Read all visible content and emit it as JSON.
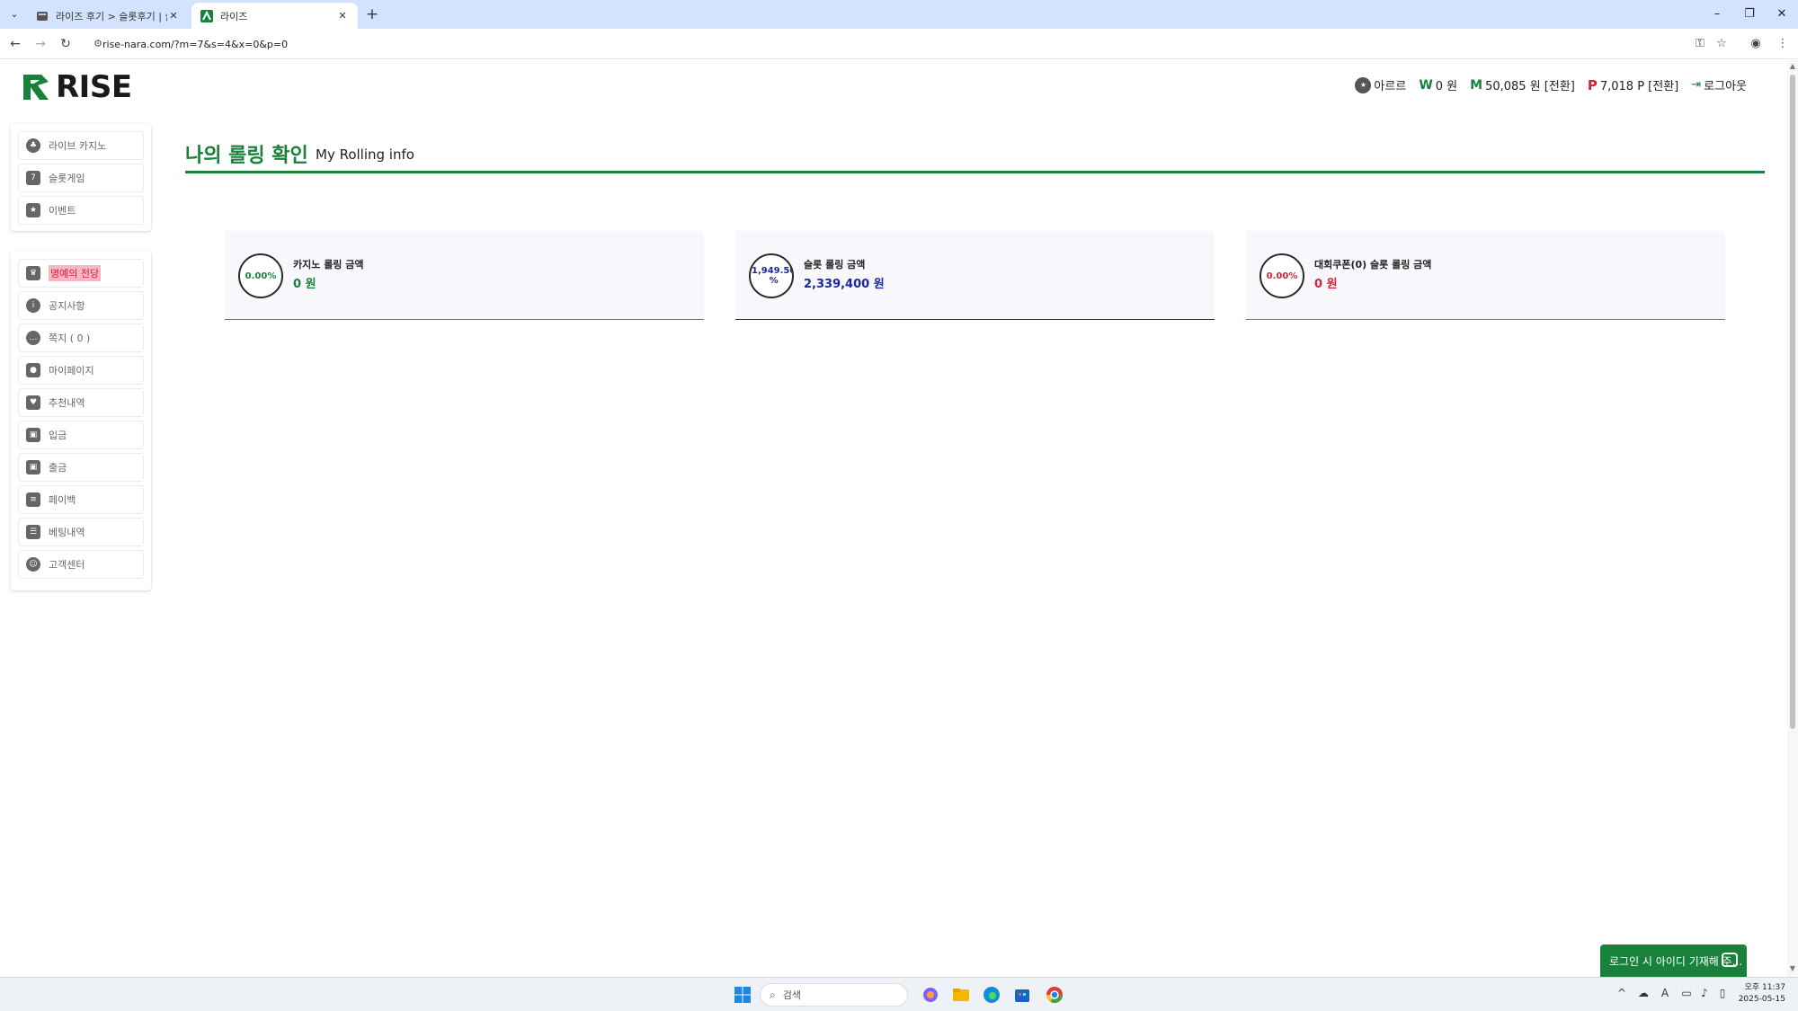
{
  "browser": {
    "tabs": [
      {
        "title": "라이즈 후기 > 슬롯후기 | 슬롯"
      },
      {
        "title": "라이즈"
      }
    ],
    "url": "rise-nara.com/?m=7&s=4&x=0&p=0",
    "window_controls": {
      "minimize": "–",
      "restore": "❐",
      "close": "✕"
    }
  },
  "site": {
    "logo_text": "RISE",
    "brand_color": "#19813b"
  },
  "userbar": {
    "username": "아르르",
    "won_symbol": "W",
    "won_value": "0 원",
    "mileage_symbol": "M",
    "mileage_value": "50,085 원 [전환]",
    "point_symbol": "P",
    "point_value": "7,018 P [전환]",
    "logout_label": "로그아웃"
  },
  "sidebar": {
    "top_items": [
      {
        "label": "라이브 카지노",
        "icon": "casino-icon"
      },
      {
        "label": "슬롯게임",
        "icon": "slot-icon"
      },
      {
        "label": "이벤트",
        "icon": "star-icon"
      }
    ],
    "bottom_items": [
      {
        "label": "명예의 전당",
        "icon": "trophy-icon",
        "highlight": true
      },
      {
        "label": "공지사항",
        "icon": "info-icon"
      },
      {
        "label": "쪽지 ( 0 )",
        "icon": "chat-icon"
      },
      {
        "label": "마이페이지",
        "icon": "user-icon"
      },
      {
        "label": "추천내역",
        "icon": "heart-icon"
      },
      {
        "label": "입금",
        "icon": "wallet-in-icon"
      },
      {
        "label": "출금",
        "icon": "wallet-out-icon"
      },
      {
        "label": "페이백",
        "icon": "payback-icon"
      },
      {
        "label": "베팅내역",
        "icon": "betting-icon"
      },
      {
        "label": "고객센터",
        "icon": "support-icon"
      }
    ]
  },
  "main": {
    "title": "나의 롤링 확인",
    "subtitle": "My Rolling info",
    "cards": [
      {
        "percent": "0.00%",
        "label": "카지노 롤링 금액",
        "amount": "0 원",
        "percent_value": 0.0
      },
      {
        "percent": "1,949.50 %",
        "label": "슬롯 롤링 금액",
        "amount": "2,339,400 원",
        "percent_value": 1949.5
      },
      {
        "percent": "0.00%",
        "label": "대회쿠폰(0) 슬롯 롤링 금액",
        "amount": "0 원",
        "percent_value": 0.0
      }
    ]
  },
  "chat_widget": {
    "label": "로그인 시 아이디 기재해 주..."
  },
  "taskbar": {
    "search_placeholder": "검색",
    "clock_time": "오후 11:37",
    "clock_date": "2025-05-15"
  }
}
